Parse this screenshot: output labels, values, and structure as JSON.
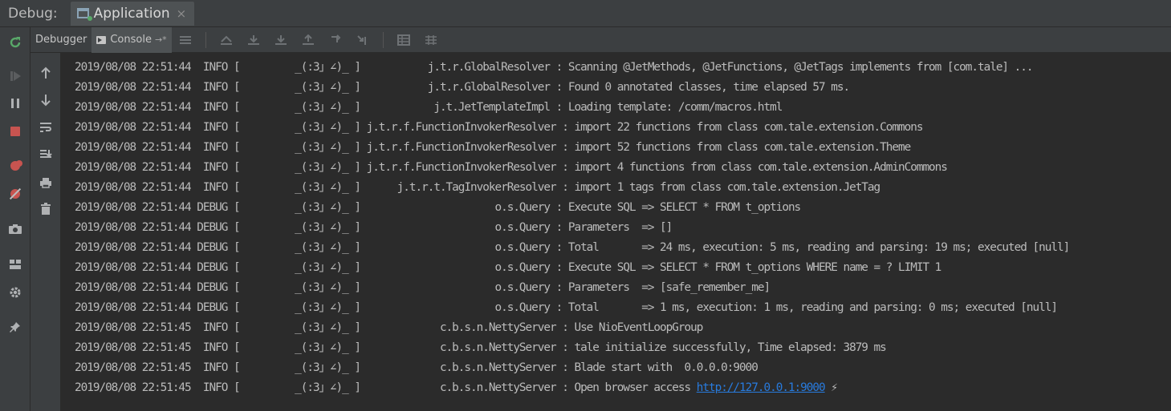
{
  "title_bar": {
    "debug_label": "Debug:",
    "tab_label": "Application",
    "close_glyph": "×"
  },
  "toolbar": {
    "debugger_tab": "Debugger",
    "console_tab": "Console",
    "pin_glyph": "→*"
  },
  "icons": {
    "left_bar": [
      "rerun-icon",
      "resume-icon",
      "pause-icon",
      "stop-icon",
      "view-breakpoints-icon",
      "mute-breakpoints-icon",
      "camera-icon",
      "layout-icon",
      "settings-icon",
      "pin-icon"
    ],
    "console_bar": [
      "up-arrow-icon",
      "down-arrow-icon",
      "soft-wrap-icon",
      "scroll-to-end-icon",
      "print-icon",
      "trash-icon"
    ],
    "toolbar": [
      "menu-icon",
      "show-execution-point-icon",
      "step-over-icon",
      "step-into-icon",
      "force-step-into-icon",
      "step-out-icon",
      "drop-frame-icon",
      "run-to-cursor-icon",
      "evaluate-icon",
      "trace-icon"
    ]
  },
  "colors": {
    "background": "#2b2b2b",
    "text": "#bbbbbb",
    "link": "#287bde",
    "stop_red": "#c75450",
    "rerun_green": "#59a869"
  },
  "console": {
    "lines": [
      "2019/08/08 22:51:44  INFO [         _(:3」∠)_ ]           j.t.r.GlobalResolver : Scanning @JetMethods, @JetFunctions, @JetTags implements from [com.tale] ...",
      "2019/08/08 22:51:44  INFO [         _(:3」∠)_ ]           j.t.r.GlobalResolver : Found 0 annotated classes, time elapsed 57 ms.",
      "2019/08/08 22:51:44  INFO [         _(:3」∠)_ ]            j.t.JetTemplateImpl : Loading template: /comm/macros.html",
      "2019/08/08 22:51:44  INFO [         _(:3」∠)_ ] j.t.r.f.FunctionInvokerResolver : import 22 functions from class com.tale.extension.Commons",
      "2019/08/08 22:51:44  INFO [         _(:3」∠)_ ] j.t.r.f.FunctionInvokerResolver : import 52 functions from class com.tale.extension.Theme",
      "2019/08/08 22:51:44  INFO [         _(:3」∠)_ ] j.t.r.f.FunctionInvokerResolver : import 4 functions from class com.tale.extension.AdminCommons",
      "2019/08/08 22:51:44  INFO [         _(:3」∠)_ ]      j.t.r.t.TagInvokerResolver : import 1 tags from class com.tale.extension.JetTag",
      "2019/08/08 22:51:44 DEBUG [         _(:3」∠)_ ]                      o.s.Query : Execute SQL => SELECT * FROM t_options",
      "2019/08/08 22:51:44 DEBUG [         _(:3」∠)_ ]                      o.s.Query : Parameters  => []",
      "2019/08/08 22:51:44 DEBUG [         _(:3」∠)_ ]                      o.s.Query : Total       => 24 ms, execution: 5 ms, reading and parsing: 19 ms; executed [null]",
      "2019/08/08 22:51:44 DEBUG [         _(:3」∠)_ ]                      o.s.Query : Execute SQL => SELECT * FROM t_options WHERE name = ? LIMIT 1",
      "2019/08/08 22:51:44 DEBUG [         _(:3」∠)_ ]                      o.s.Query : Parameters  => [safe_remember_me]",
      "2019/08/08 22:51:44 DEBUG [         _(:3」∠)_ ]                      o.s.Query : Total       => 1 ms, execution: 1 ms, reading and parsing: 0 ms; executed [null]",
      "2019/08/08 22:51:45  INFO [         _(:3」∠)_ ]             c.b.s.n.NettyServer : Use NioEventLoopGroup",
      "2019/08/08 22:51:45  INFO [         _(:3」∠)_ ]             c.b.s.n.NettyServer : tale initialize successfully, Time elapsed: 3879 ms",
      "2019/08/08 22:51:45  INFO [         _(:3」∠)_ ]             c.b.s.n.NettyServer : Blade start with  0.0.0.0:9000"
    ],
    "last_line_prefix": "2019/08/08 22:51:45  INFO [         _(:3」∠)_ ]             c.b.s.n.NettyServer : Open browser access ",
    "last_line_link": "http://127.0.0.1:9000",
    "last_line_suffix": " ⚡"
  }
}
